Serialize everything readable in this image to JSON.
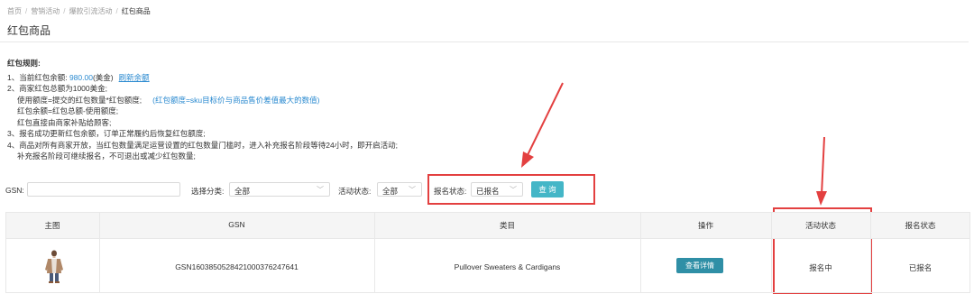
{
  "breadcrumb": [
    "首页",
    "营销活动",
    "爆款引流活动",
    "红包商品"
  ],
  "page_title": "红包商品",
  "rules": {
    "heading": "红包规则:",
    "line1_prefix": "1、当前红包余额: ",
    "balance": "980.00",
    "line1_suffix": "(美金)",
    "refresh_link": "刷新余额",
    "line2": "2、商家红包总额为1000美金;",
    "line2a_prefix": "使用额度=提交的红包数量*红包额度;",
    "line2a_note": "(红包额度=sku目标价与商品售价差值最大的数值)",
    "line2b": "红包余额=红包总额-使用额度;",
    "line2c": "红包直接由商家补贴给顾客;",
    "line3": "3、报名成功更新红包余额，订单正常履约后恢复红包额度;",
    "line4": "4、商品对所有商家开放，当红包数量满足运营设置的红包数量门槛时，进入补充报名阶段等待24小时，即开启活动;",
    "line4a": "补充报名阶段可继续报名，不可退出或减少红包数量;"
  },
  "filters": {
    "gsn_label": "GSN:",
    "gsn_value": "",
    "category_label": "选择分类:",
    "category_value": "全部",
    "activity_label": "活动状态:",
    "activity_value": "全部",
    "signup_label": "报名状态:",
    "signup_value": "已报名",
    "query_button": "查 询"
  },
  "table": {
    "headers": [
      "主图",
      "GSN",
      "类目",
      "操作",
      "活动状态",
      "报名状态"
    ],
    "rows": [
      {
        "image": "product-thumbnail",
        "gsn": "GSN1603850528421000376247641",
        "category": "Pullover Sweaters & Cardigans",
        "action": "查看详情",
        "activity_status": "报名中",
        "signup_status": "已报名"
      }
    ]
  },
  "colors": {
    "accent": "#44b6c7",
    "detail_button": "#2f8fa6",
    "link": "#2a8ad0",
    "annotation_red": "#e34040"
  }
}
